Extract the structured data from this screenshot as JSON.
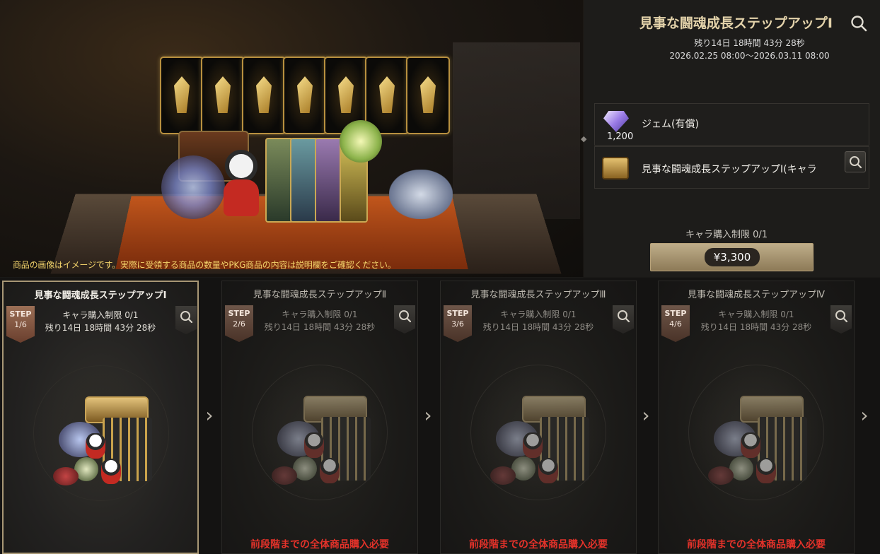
{
  "banner": {
    "disclaimer": "商品の画像はイメージです。実際に受領する商品の数量やPKG商品の内容は説明欄をご確認ください。"
  },
  "detail": {
    "title": "見事な闘魂成長ステップアップⅠ",
    "remaining": "残り14日 18時間 43分 28秒",
    "period": "2026.02.25 08:00～2026.03.11 08:00",
    "items": [
      {
        "icon": "gem-icon",
        "label": "ジェム(有償)",
        "count": "1,200"
      },
      {
        "icon": "treasure-box-icon",
        "label": "見事な闘魂成長ステップアップⅠ(キャラ"
      }
    ],
    "purchase_limit": "キャラ購入制限 0/1",
    "price": "¥3,300"
  },
  "steps": [
    {
      "title": "見事な闘魂成長ステップアップⅠ",
      "badge_label": "STEP",
      "badge_num": "1/6",
      "limit": "キャラ購入制限 0/1",
      "remaining": "残り14日 18時間 43分 28秒",
      "requirement": ""
    },
    {
      "title": "見事な闘魂成長ステップアップⅡ",
      "badge_label": "STEP",
      "badge_num": "2/6",
      "limit": "キャラ購入制限 0/1",
      "remaining": "残り14日 18時間 43分 28秒",
      "requirement": "前段階までの全体商品購入必要"
    },
    {
      "title": "見事な闘魂成長ステップアップⅢ",
      "badge_label": "STEP",
      "badge_num": "3/6",
      "limit": "キャラ購入制限 0/1",
      "remaining": "残り14日 18時間 43分 28秒",
      "requirement": "前段階までの全体商品購入必要"
    },
    {
      "title": "見事な闘魂成長ステップアップⅣ",
      "badge_label": "STEP",
      "badge_num": "4/6",
      "limit": "キャラ購入制限 0/1",
      "remaining": "残り14日 18時間 43分 28秒",
      "requirement": "前段階までの全体商品購入必要"
    }
  ],
  "colors": {
    "accent": "#e3d2aa",
    "warning": "#e4322a",
    "notice": "#f2d36b"
  }
}
